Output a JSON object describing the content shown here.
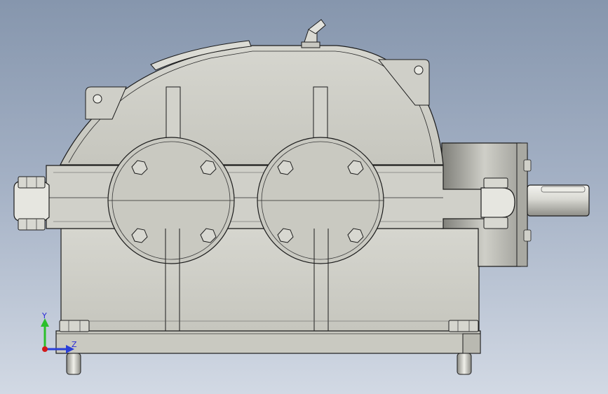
{
  "scene": {
    "background_top": "#8696ad",
    "background_bottom": "#d2d9e4",
    "body_color": "#cbcbc3",
    "edge_color": "#1c1c1c"
  },
  "triad": {
    "y_label": "Y",
    "z_label": "Z",
    "y_color": "#2bbf2b",
    "z_color": "#2a3fd8",
    "x_color": "#d21a1a"
  },
  "icons": [
    "grease-nipple-icon",
    "view-orientation-triad-icon"
  ]
}
